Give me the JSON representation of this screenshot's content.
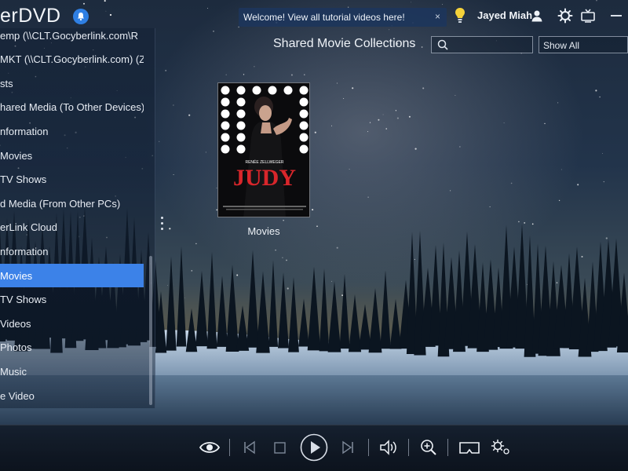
{
  "app": {
    "title": "erDVD"
  },
  "header": {
    "welcome_text": "Welcome! View all tutorial videos here!",
    "welcome_close": "×",
    "user_name": "Jayed Miah"
  },
  "sidebar": {
    "items": [
      {
        "label": "emp (\\\\CLT.Gocyberlink.com\\R",
        "active": false
      },
      {
        "label": "MKT (\\\\CLT.Gocyberlink.com) (Z",
        "active": false
      },
      {
        "label": "sts",
        "active": false
      },
      {
        "label": "hared Media (To Other Devices)",
        "active": false
      },
      {
        "label": "nformation",
        "active": false
      },
      {
        "label": "Movies",
        "active": false
      },
      {
        "label": "TV Shows",
        "active": false
      },
      {
        "label": "d Media (From Other PCs)",
        "active": false
      },
      {
        "label": "erLink Cloud",
        "active": false
      },
      {
        "label": "nformation",
        "active": false
      },
      {
        "label": "Movies",
        "active": true
      },
      {
        "label": "TV Shows",
        "active": false
      },
      {
        "label": "Videos",
        "active": false
      },
      {
        "label": "Photos",
        "active": false
      },
      {
        "label": "Music",
        "active": false
      },
      {
        "label": "e Video",
        "active": false
      }
    ]
  },
  "main": {
    "section_title": "Shared Movie Collections",
    "search": {
      "placeholder": ""
    },
    "filter": {
      "selected": "Show All"
    },
    "collections": [
      {
        "caption": "Movies",
        "count": "1",
        "poster": {
          "title": "JUDY",
          "credit": "RENÉE ZELLWEGER"
        }
      }
    ]
  },
  "player": {
    "controls": [
      "eye-icon",
      "previous-icon",
      "stop-icon",
      "play-icon",
      "next-icon",
      "volume-icon",
      "zoom-icon",
      "vr-icon",
      "settings-icon"
    ]
  },
  "colors": {
    "accent": "#3c82e8",
    "bell": "#2f7fe3",
    "bulb": "#f5d23a",
    "poster_title": "#d8262b"
  }
}
